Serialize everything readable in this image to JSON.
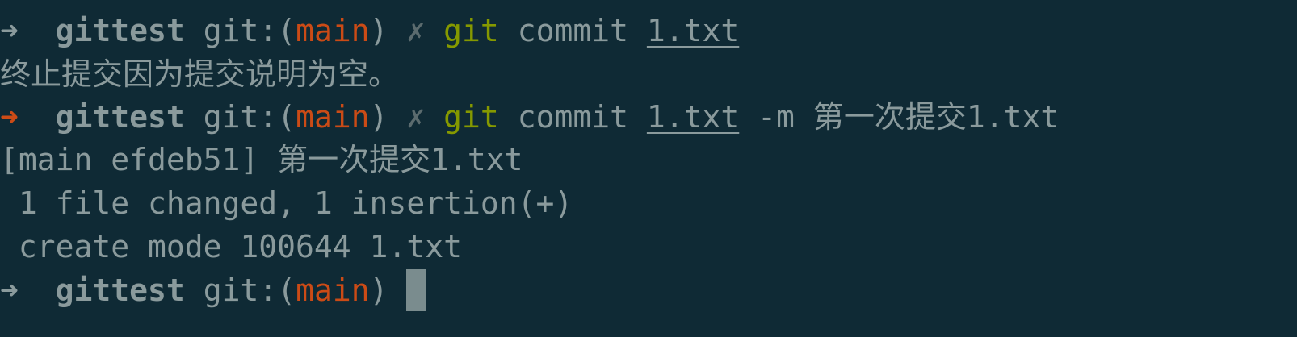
{
  "terminal": {
    "line1": {
      "arrow": "➜",
      "dir": "gittest",
      "git_label": "git:(",
      "branch": "main",
      "git_close": ")",
      "dirty": "✗",
      "cmd": "git",
      "subcmd": "commit",
      "path": "1.txt"
    },
    "line2": {
      "text": "终止提交因为提交说明为空。"
    },
    "line3": {
      "arrow": "➜",
      "dir": "gittest",
      "git_label": "git:(",
      "branch": "main",
      "git_close": ")",
      "dirty": "✗",
      "cmd": "git",
      "subcmd": "commit",
      "path": "1.txt",
      "flag": "-m",
      "message": "第一次提交1.txt"
    },
    "line4": {
      "text": "[main efdeb51] 第一次提交1.txt"
    },
    "line5": {
      "text": " 1 file changed, 1 insertion(+)"
    },
    "line6": {
      "text": " create mode 100644 1.txt"
    },
    "line7": {
      "arrow": "➜",
      "dir": "gittest",
      "git_label": "git:(",
      "branch": "main",
      "git_close": ")"
    }
  },
  "colors": {
    "background": "#0f2a35",
    "text": "#8a9a9c",
    "branch": "#cb4b16",
    "command": "#859900",
    "error_arrow": "#cb4b16"
  }
}
